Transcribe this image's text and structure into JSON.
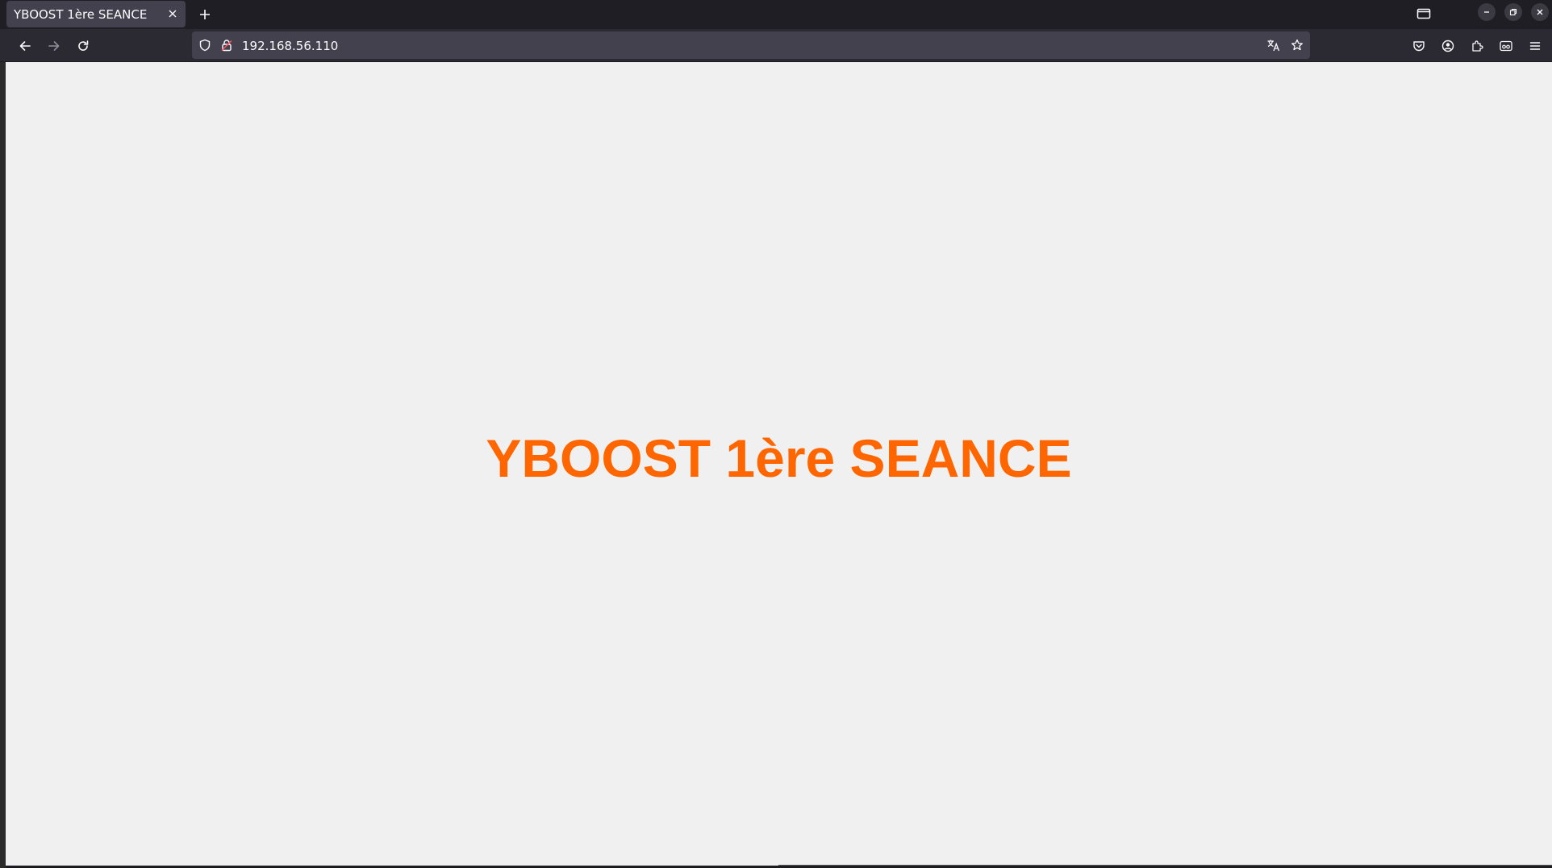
{
  "browser": {
    "tab": {
      "title": "YBOOST 1ère SEANCE"
    },
    "address_bar": {
      "url": "192.168.56.110"
    }
  },
  "page": {
    "heading": "YBOOST 1ère SEANCE",
    "heading_color": "#ff6600",
    "background_color": "#f0f0f0"
  }
}
